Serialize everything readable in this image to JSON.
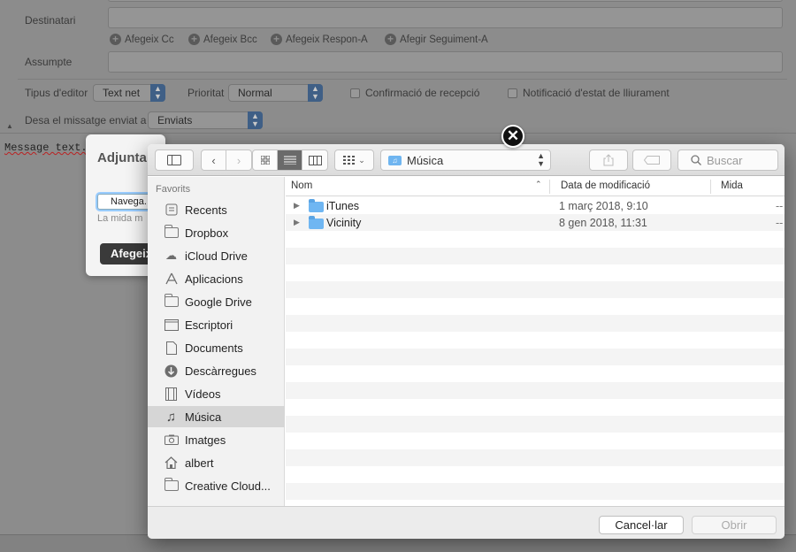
{
  "compose": {
    "recipients_label": "Destinatari",
    "add_links": [
      "Afegeix Cc",
      "Afegeix Bcc",
      "Afegeix Respon-A",
      "Afegir Seguiment-A"
    ],
    "subject_label": "Assumpte",
    "editor_type_label": "Tipus d'editor",
    "editor_type_value": "Text net",
    "priority_label": "Prioritat",
    "priority_value": "Normal",
    "read_receipt_label": "Confirmació de recepció",
    "delivery_status_label": "Notificació d'estat de lliurament",
    "save_sent_label": "Desa el missatge enviat a",
    "save_sent_value": "Enviats",
    "message_text": "Message text."
  },
  "attach_dialog": {
    "title": "Adjunta",
    "browse_label": "Navega...",
    "note": "La mida m",
    "add_button": "Afegeix"
  },
  "file_picker": {
    "location": "Música",
    "search_placeholder": "Buscar",
    "sidebar_heading": "Favorits",
    "sidebar_items": [
      {
        "label": "Recents",
        "icon": "recents-icon"
      },
      {
        "label": "Dropbox",
        "icon": "folder-icon"
      },
      {
        "label": "iCloud Drive",
        "icon": "cloud-icon"
      },
      {
        "label": "Aplicacions",
        "icon": "applications-icon"
      },
      {
        "label": "Google Drive",
        "icon": "folder-icon"
      },
      {
        "label": "Escriptori",
        "icon": "desktop-icon"
      },
      {
        "label": "Documents",
        "icon": "document-icon"
      },
      {
        "label": "Descàrregues",
        "icon": "download-icon"
      },
      {
        "label": "Vídeos",
        "icon": "film-icon"
      },
      {
        "label": "Música",
        "icon": "music-icon"
      },
      {
        "label": "Imatges",
        "icon": "camera-icon"
      },
      {
        "label": "albert",
        "icon": "home-icon"
      },
      {
        "label": "Creative Cloud...",
        "icon": "folder-icon"
      }
    ],
    "selected_sidebar_item": "Música",
    "columns": {
      "name": "Nom",
      "modified": "Data de modificació",
      "size": "Mida"
    },
    "rows": [
      {
        "name": "iTunes",
        "modified": "1 març 2018, 9:10",
        "size": "--"
      },
      {
        "name": "Vicinity",
        "modified": "8 gen 2018, 11:31",
        "size": "--"
      }
    ],
    "cancel_button": "Cancel·lar",
    "open_button": "Obrir"
  }
}
